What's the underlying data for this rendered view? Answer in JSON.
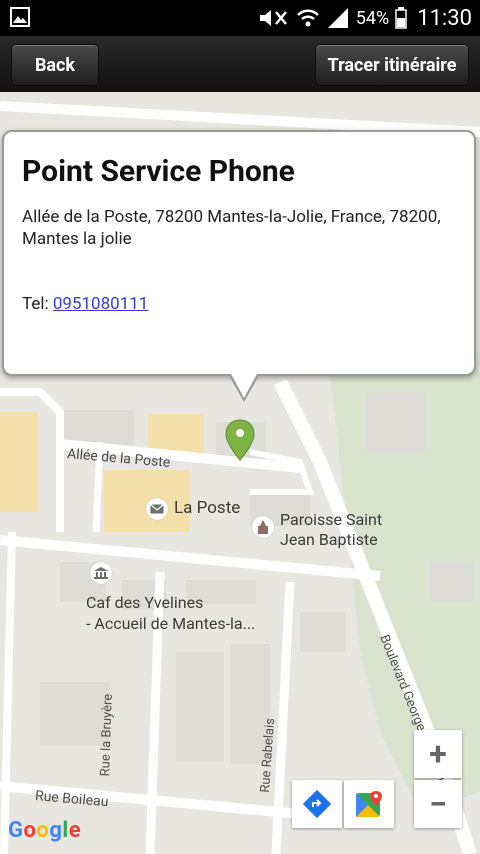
{
  "status_bar": {
    "battery": "54%",
    "time": "11:30"
  },
  "toolbar": {
    "back_label": "Back",
    "route_label": "Tracer itinéraire"
  },
  "info_window": {
    "title": "Point Service Phone",
    "address": "Allée de la Poste, 78200 Mantes-la-Jolie, France, 78200, Mantes la jolie",
    "tel_label": "Tel:",
    "tel_number": "0951080111"
  },
  "map_labels": {
    "allee_poste": "Allée de la Poste",
    "la_poste": "La Poste",
    "paroisse_line1": "Paroisse Saint",
    "paroisse_line2": "Jean Baptiste",
    "caf_line1": "Caf des Yvelines",
    "caf_line2": "- Accueil de Mantes-la...",
    "boulevard": "Boulevard Georges Clemenceau",
    "rue_bruyere": "Rue la Bruyère",
    "rue_rabelais": "Rue Rabelais",
    "rue_boileau": "Rue Boileau"
  },
  "controls": {
    "zoom_in": "+",
    "zoom_out": "−"
  },
  "attribution": {
    "google": "Google"
  },
  "colors": {
    "marker": "#7cb342",
    "link": "#3b3bcf",
    "building": "#f5dfa8",
    "map_bg": "#e8e6e1",
    "park": "#d9e2cc"
  }
}
